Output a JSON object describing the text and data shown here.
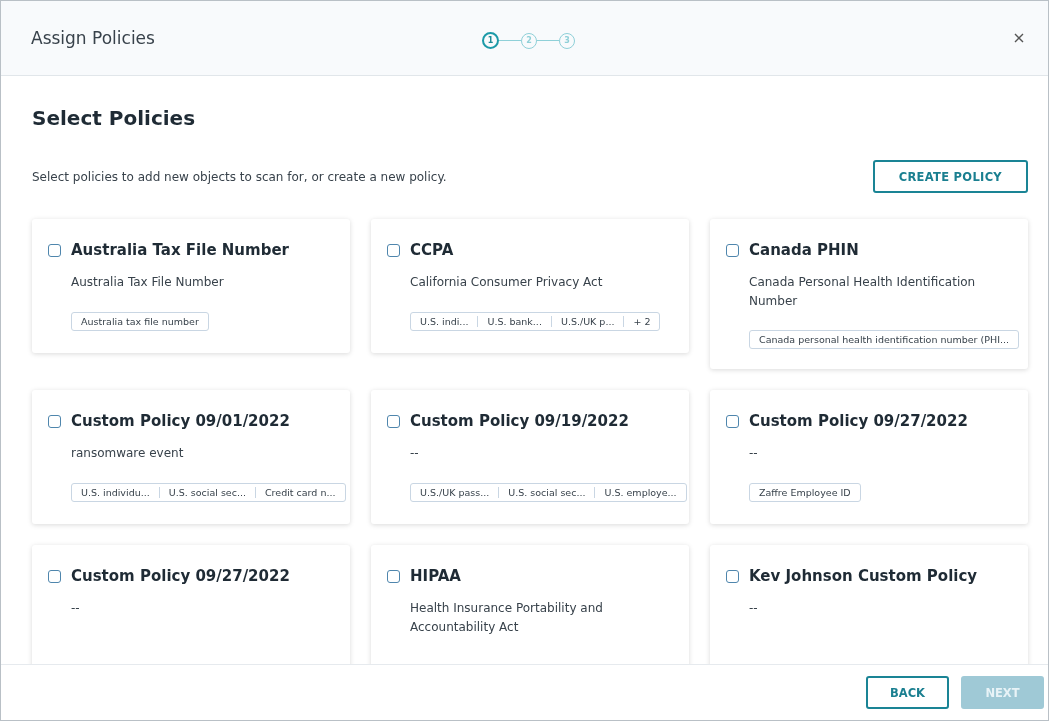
{
  "window": {
    "title": "Assign Policies"
  },
  "steps": [
    {
      "label": "1",
      "selected": true
    },
    {
      "label": "2",
      "selected": false
    },
    {
      "label": "3",
      "selected": false
    }
  ],
  "heading": "Select Policies",
  "description": "Select policies to add new objects to scan for, or create a new policy.",
  "create_button": "CREATE POLICY",
  "policies": [
    {
      "name": "Australia Tax File Number",
      "description": "Australia Tax File Number",
      "checked": false,
      "tags": [
        "Australia tax file number"
      ]
    },
    {
      "name": "CCPA",
      "description": "California Consumer Privacy Act",
      "checked": false,
      "tags": [
        "U.S. indi...",
        "U.S. bank...",
        "U.S./UK p...",
        "+ 2"
      ]
    },
    {
      "name": "Canada PHIN",
      "description": "Canada Personal Health Identification Number",
      "checked": false,
      "tags": [
        "Canada personal health identification number (PHI..."
      ]
    },
    {
      "name": "Custom Policy 09/01/2022",
      "description": "ransomware event",
      "checked": false,
      "tags": [
        "U.S. individu...",
        "U.S. social sec...",
        "Credit card n..."
      ]
    },
    {
      "name": "Custom Policy 09/19/2022",
      "description": "--",
      "checked": false,
      "tags": [
        "U.S./UK pass...",
        "U.S. social sec...",
        "U.S. employe..."
      ]
    },
    {
      "name": "Custom Policy 09/27/2022",
      "description": "--",
      "checked": false,
      "tags": [
        "Zaffre Employee ID"
      ]
    },
    {
      "name": "Custom Policy 09/27/2022",
      "description": "--",
      "checked": false
    },
    {
      "name": "HIPAA",
      "description": "Health Insurance Portability and Accountability Act",
      "checked": false
    },
    {
      "name": "Kev Johnson Custom Policy",
      "description": "--",
      "checked": false
    }
  ],
  "footer": {
    "back": "BACK",
    "next": "NEXT",
    "next_disabled": true
  }
}
